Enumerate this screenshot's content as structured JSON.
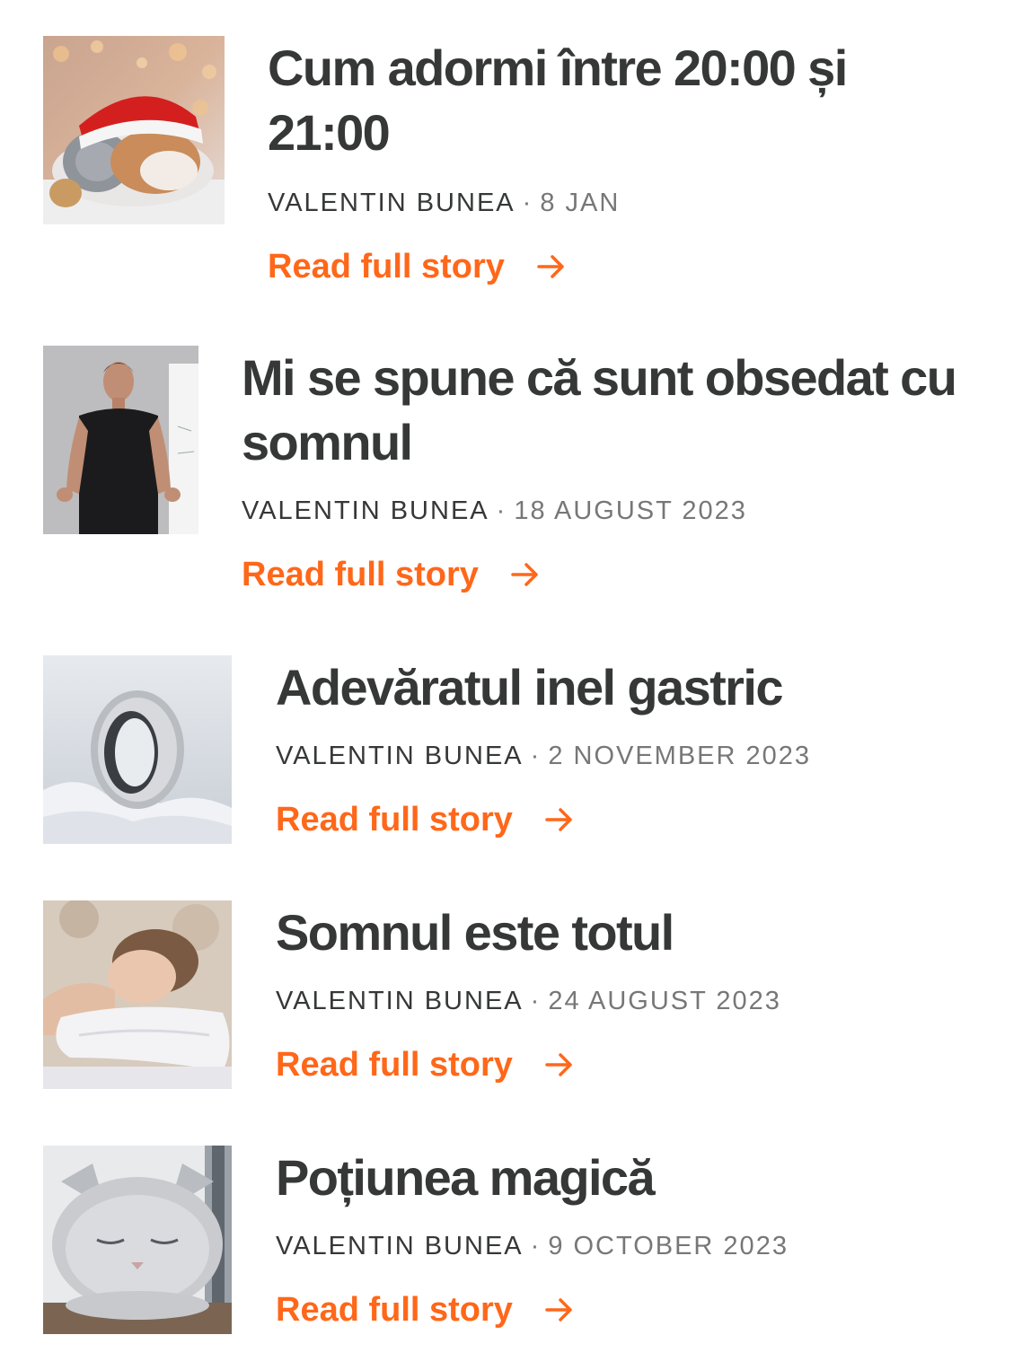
{
  "accent_color": "#ff6719",
  "stories": [
    {
      "title": "Cum adormi între 20:00 și 21:00",
      "author": "VALENTIN BUNEA",
      "separator": "·",
      "date": "8 JAN",
      "cta": "Read full story",
      "thumbnail": "kitten-and-puppy-in-santa-hat-image"
    },
    {
      "title": "Mi se spune că sunt obsedat cu somnul",
      "author": "VALENTIN BUNEA",
      "separator": "·",
      "date": "18 AUGUST 2023",
      "cta": "Read full story",
      "thumbnail": "man-in-black-tshirt-presenting-image"
    },
    {
      "title": "Adevăratul inel gastric",
      "author": "VALENTIN BUNEA",
      "separator": "·",
      "date": "2 NOVEMBER 2023",
      "cta": "Read full story",
      "thumbnail": "smart-ring-in-snow-image"
    },
    {
      "title": "Somnul este totul",
      "author": "VALENTIN BUNEA",
      "separator": "·",
      "date": "24 AUGUST 2023",
      "cta": "Read full story",
      "thumbnail": "woman-sleeping-on-pillow-image"
    },
    {
      "title": "Poțiunea magică",
      "author": "VALENTIN BUNEA",
      "separator": "·",
      "date": "9 OCTOBER 2023",
      "cta": "Read full story",
      "thumbnail": "sleeping-grey-cat-image"
    }
  ]
}
